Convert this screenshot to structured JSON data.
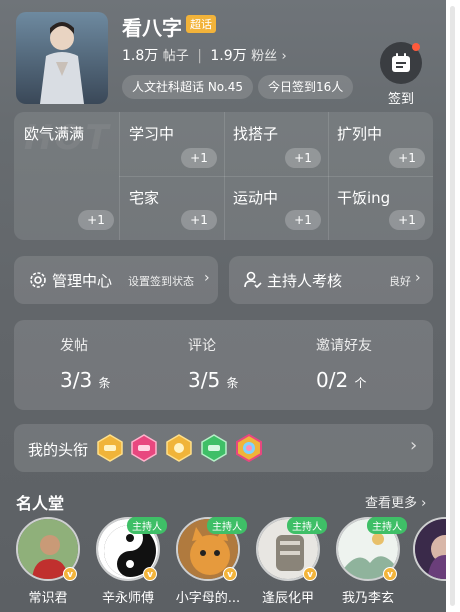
{
  "header": {
    "title": "看八字",
    "super_badge": "超话",
    "posts_count": "1.8万",
    "posts_label": "帖子",
    "fans_count": "1.9万",
    "fans_label": "粉丝",
    "fans_arrow": "›",
    "rank_pill": "人文社科超话 No.45",
    "checkin_pill": "今日签到16人",
    "checkin_label": "签到"
  },
  "tags": {
    "watermark": "HOT",
    "plus_label": "+1",
    "items": [
      {
        "label": "欧气满满"
      },
      {
        "label": "学习中"
      },
      {
        "label": "找搭子"
      },
      {
        "label": "扩列中"
      },
      {
        "label": "宅家"
      },
      {
        "label": "运动中"
      },
      {
        "label": "干饭ing"
      }
    ]
  },
  "management": {
    "admin_label": "管理中心",
    "admin_sub": "设置签到状态",
    "host_label": "主持人考核",
    "host_sub": "良好",
    "arrow": "›"
  },
  "stats_card": {
    "items": [
      {
        "label": "发帖",
        "value": "3/3",
        "unit": "条"
      },
      {
        "label": "评论",
        "value": "3/5",
        "unit": "条"
      },
      {
        "label": "邀请好友",
        "value": "0/2",
        "unit": "个"
      }
    ]
  },
  "titles": {
    "label": "我的头衔",
    "arrow": "›",
    "badges": [
      {
        "icon": "hexagon-badge-gold-icon",
        "color": "#f0b43a"
      },
      {
        "icon": "hexagon-badge-pink-icon",
        "color": "#e8477f"
      },
      {
        "icon": "hexagon-badge-orange-icon",
        "color": "#f0b43a"
      },
      {
        "icon": "hexagon-badge-green-icon",
        "color": "#3fbf67"
      },
      {
        "icon": "hexagon-badge-rainbow-icon",
        "color": "#f0b43a"
      }
    ]
  },
  "hall": {
    "title": "名人堂",
    "more_label": "查看更多 ›",
    "host_tag": "主持人",
    "verified_mark": "v",
    "people": [
      {
        "name": "常识君",
        "has_host_tag": false
      },
      {
        "name": "辛永师傅",
        "has_host_tag": true
      },
      {
        "name": "小字母的...",
        "has_host_tag": true
      },
      {
        "name": "逢辰化甲",
        "has_host_tag": true
      },
      {
        "name": "我乃李玄",
        "has_host_tag": true
      },
      {
        "name": "",
        "has_host_tag": false
      }
    ]
  },
  "colors": {
    "accent_gold": "#f2b33a",
    "host_green": "#3fbf67",
    "notify_red": "#ff5a3c"
  }
}
